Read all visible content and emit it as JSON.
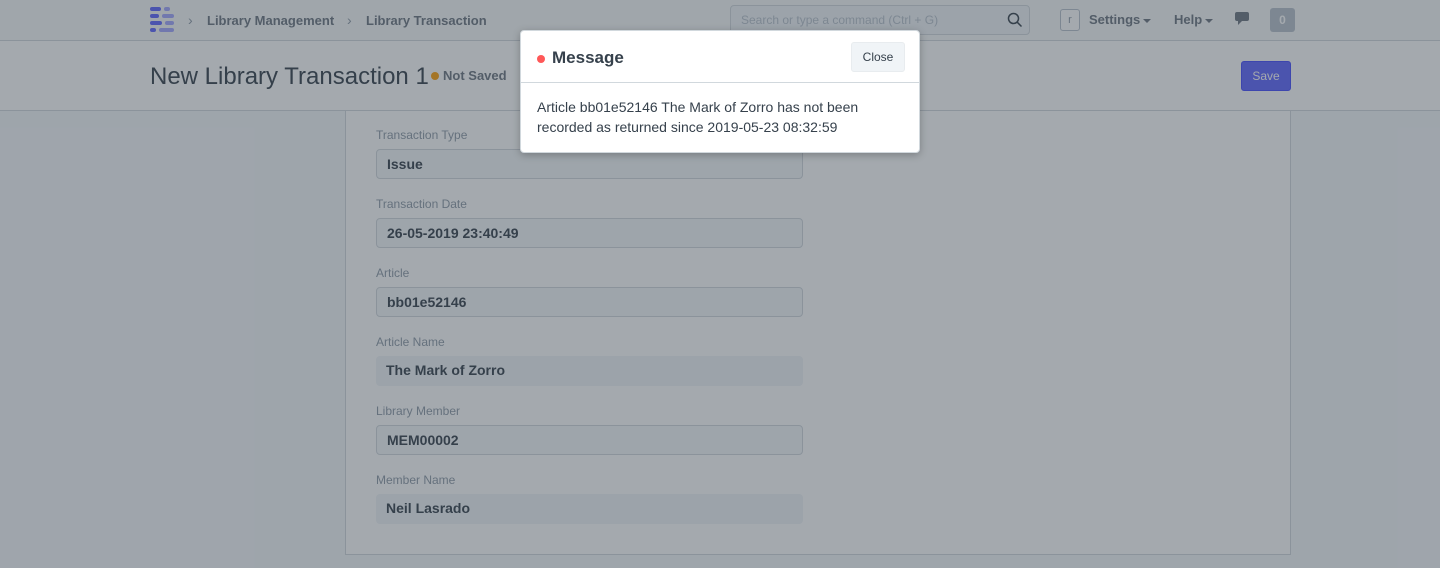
{
  "navbar": {
    "breadcrumbs": [
      "Library Management",
      "Library Transaction"
    ],
    "search_placeholder": "Search or type a command (Ctrl + G)",
    "avatar_initial": "r",
    "settings_label": "Settings",
    "help_label": "Help",
    "notification_count": "0"
  },
  "page": {
    "title": "New Library Transaction 1",
    "status": "Not Saved",
    "save_label": "Save"
  },
  "form": {
    "fields": [
      {
        "label": "Transaction Type",
        "value": "Issue"
      },
      {
        "label": "Transaction Date",
        "value": "26-05-2019 23:40:49"
      },
      {
        "label": "Article",
        "value": "bb01e52146"
      },
      {
        "label": "Article Name",
        "value": "The Mark of Zorro"
      },
      {
        "label": "Library Member",
        "value": "MEM00002"
      },
      {
        "label": "Member Name",
        "value": "Neil Lasrado"
      }
    ]
  },
  "dialog": {
    "title": "Message",
    "close_label": "Close",
    "message": "Article bb01e52146 The Mark of Zorro has not been recorded as returned since 2019-05-23 08:32:59",
    "indicator_color": "#ff5858"
  },
  "colors": {
    "primary": "#5e64ff",
    "not_saved_indicator": "#ffa00a"
  }
}
